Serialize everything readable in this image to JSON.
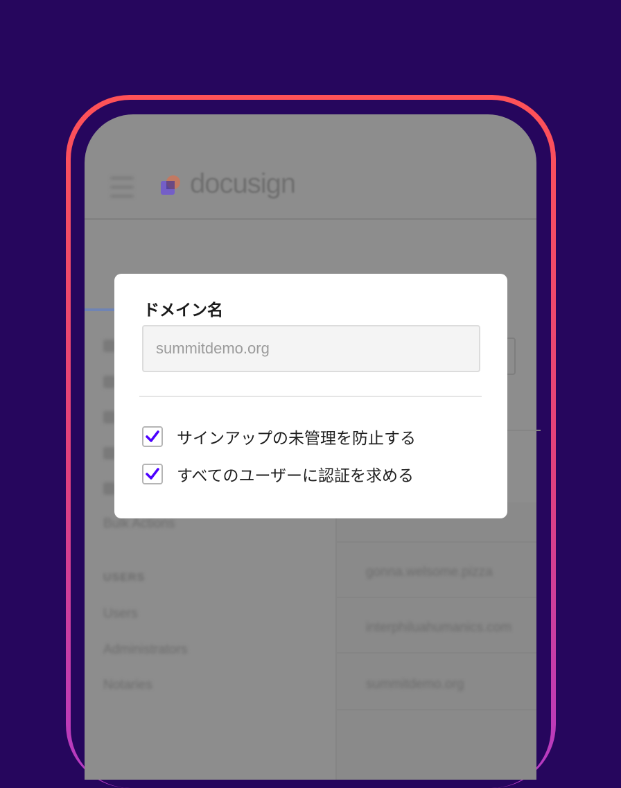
{
  "brand": {
    "name": "docusign"
  },
  "sidebar": {
    "items_top": [
      "Bulk Actions"
    ],
    "users_heading": "USERS",
    "users_items": [
      "Users",
      "Administrators",
      "Notaries"
    ]
  },
  "table": {
    "domains": [
      "gonna.welsome.pizza",
      "interphiluahumanics.com",
      "summitdemo.org"
    ]
  },
  "modal": {
    "title": "ドメイン名",
    "domain_placeholder": "summitdemo.org",
    "options": [
      {
        "label": "サインアップの未管理を防止する",
        "checked": true
      },
      {
        "label": "すべてのユーザーに認証を求める",
        "checked": true
      }
    ]
  },
  "colors": {
    "background": "#26065d",
    "frame_gradient_top": "#ff5257",
    "frame_gradient_bottom": "#b43ac6",
    "check_accent": "#4c00ff"
  }
}
